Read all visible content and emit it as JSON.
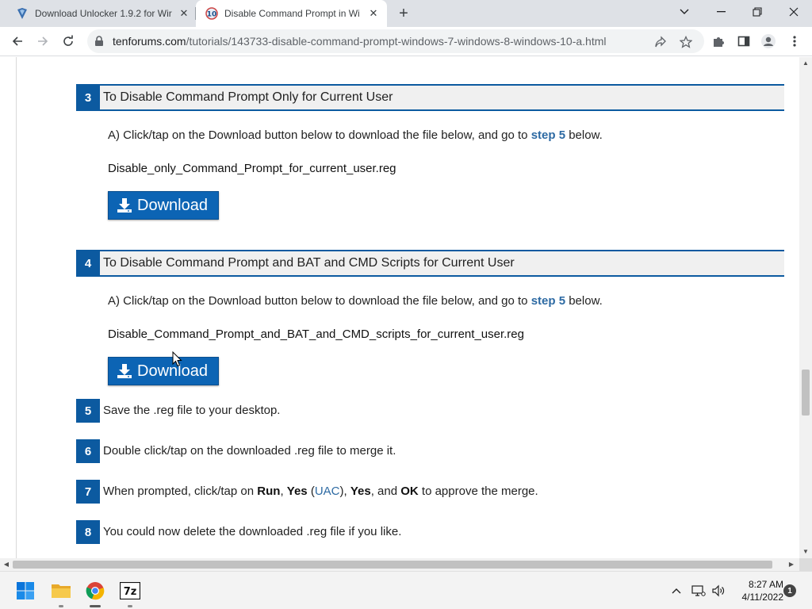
{
  "browser": {
    "tabs": [
      {
        "title": "Download Unlocker 1.9.2 for Wir",
        "icon": "unlocker-favicon"
      },
      {
        "title": "Disable Command Prompt in Wi",
        "icon": "tenforums-favicon"
      }
    ],
    "close_glyph": "✕",
    "new_tab_glyph": "+",
    "url_host": "tenforums.com",
    "url_path": "/tutorials/143733-disable-command-prompt-windows-7-windows-8-windows-10-a.html"
  },
  "content": {
    "step3": {
      "number": "3",
      "title": "To Disable Command Prompt Only for Current User",
      "instruction_pre": "A) Click/tap on the Download button below to download the file below, and go to ",
      "instruction_link": "step 5",
      "instruction_post": " below.",
      "filename": "Disable_only_Command_Prompt_for_current_user.reg",
      "button_label": "Download"
    },
    "step4": {
      "number": "4",
      "title": "To Disable Command Prompt and BAT and CMD Scripts for Current User",
      "instruction_pre": "A) Click/tap on the Download button below to download the file below, and go to ",
      "instruction_link": "step 5",
      "instruction_post": " below.",
      "filename": "Disable_Command_Prompt_and_BAT_and_CMD_scripts_for_current_user.reg",
      "button_label": "Download"
    },
    "step5": {
      "number": "5",
      "text": "Save the .reg file to your desktop."
    },
    "step6": {
      "number": "6",
      "text": "Double click/tap on the downloaded .reg file to merge it."
    },
    "step7": {
      "number": "7",
      "t1": "When prompted, click/tap on ",
      "b_run": "Run",
      "t2": ", ",
      "b_yes": "Yes",
      "t3": " (",
      "uac": "UAC",
      "t4": "), ",
      "b_yes2": "Yes",
      "t5": ", and ",
      "b_ok": "OK",
      "t6": " to approve the merge."
    },
    "step8": {
      "number": "8",
      "text": "You could now delete the downloaded .reg file if you like."
    }
  },
  "taskbar": {
    "apps": [
      "windows-start",
      "file-explorer",
      "chrome",
      "7-zip"
    ],
    "sevenzip_label": "7z",
    "time": "8:27 AM",
    "date": "4/11/2022",
    "notification_count": "1"
  },
  "colors": {
    "accent_blue": "#0c5aa0",
    "button_blue": "#0c64b4",
    "link_blue": "#2d6aa3",
    "header_bg": "#f0f0f0"
  }
}
